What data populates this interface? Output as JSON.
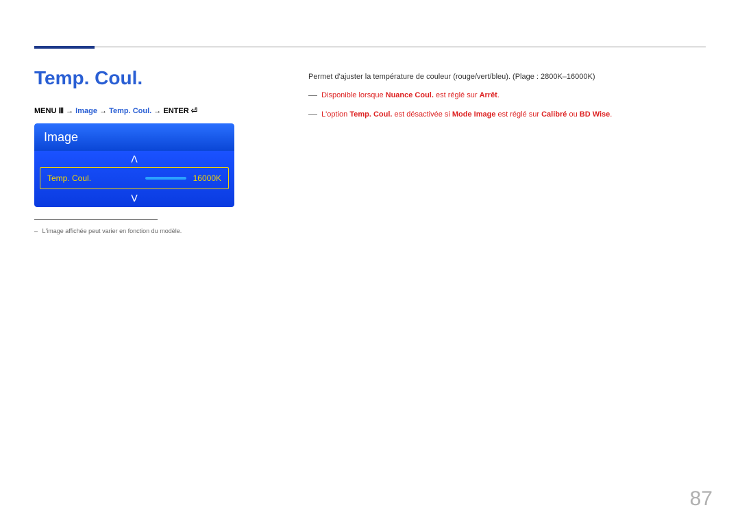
{
  "page": {
    "title": "Temp. Coul.",
    "number": "87"
  },
  "breadcrumb": {
    "menu": "MENU",
    "menu_glyph": "Ⅲ",
    "arrow": " → ",
    "image": "Image",
    "tempcoul": "Temp. Coul.",
    "enter": "ENTER",
    "enter_glyph": "⏎"
  },
  "osd": {
    "header": "Image",
    "item_label": "Temp. Coul.",
    "item_value": "16000K",
    "chev_up": "ᐱ",
    "chev_down": "ᐯ"
  },
  "footnote": {
    "dash": "–",
    "text": "L'image affichée peut varier en fonction du modèle."
  },
  "description": {
    "main": "Permet d'ajuster la température de couleur (rouge/vert/bleu). (Plage : 2800K–16000K)",
    "note1_dash": "―",
    "note1_pre": "Disponible lorsque ",
    "note1_bold": "Nuance Coul.",
    "note1_mid": " est réglé sur ",
    "note1_end": "Arrêt",
    "note1_period": ".",
    "note2_dash": "―",
    "note2_a": "L'option ",
    "note2_b": "Temp. Coul.",
    "note2_c": " est désactivée si ",
    "note2_d": "Mode Image",
    "note2_e": " est réglé sur ",
    "note2_f": "Calibré",
    "note2_g": " ou ",
    "note2_h": "BD Wise",
    "note2_i": "."
  }
}
